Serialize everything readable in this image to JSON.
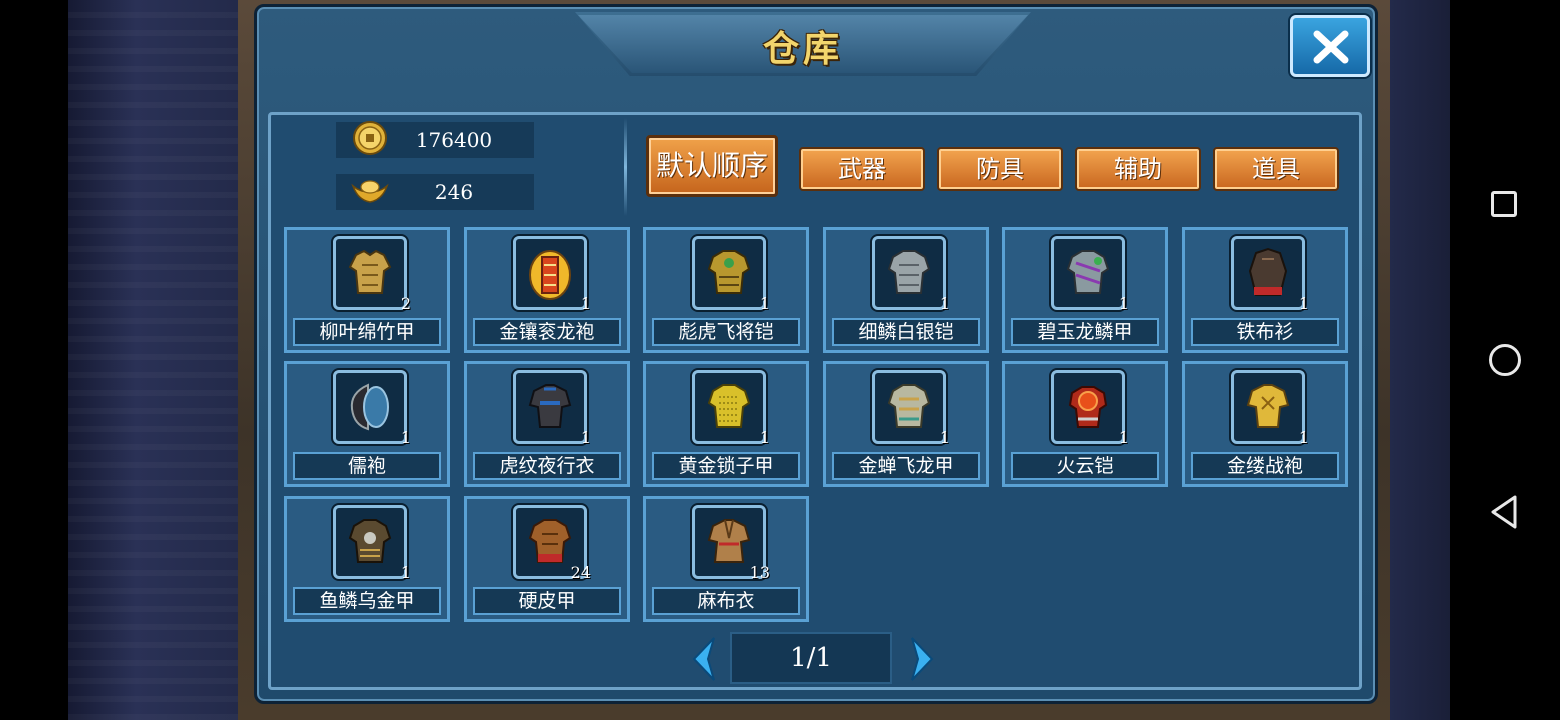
{
  "window": {
    "title": "仓库"
  },
  "currency": {
    "coins": "176400",
    "ingots": "246"
  },
  "sort": {
    "label": "默认顺序"
  },
  "categories": [
    "武器",
    "防具",
    "辅助",
    "道具"
  ],
  "items": [
    {
      "name": "柳叶绵竹甲",
      "count": "2",
      "icon": "armor-gold-icon"
    },
    {
      "name": "金镶衮龙袍",
      "count": "1",
      "icon": "robe-gold-icon"
    },
    {
      "name": "彪虎飞将铠",
      "count": "1",
      "icon": "armor-tiger-icon"
    },
    {
      "name": "细鳞白银铠",
      "count": "1",
      "icon": "armor-silver-icon"
    },
    {
      "name": "碧玉龙鳞甲",
      "count": "1",
      "icon": "armor-jade-icon"
    },
    {
      "name": "铁布衫",
      "count": "1",
      "icon": "robe-iron-icon"
    },
    {
      "name": "儒袍",
      "count": "1",
      "icon": "robe-scholar-icon"
    },
    {
      "name": "虎纹夜行衣",
      "count": "1",
      "icon": "robe-night-icon"
    },
    {
      "name": "黄金锁子甲",
      "count": "1",
      "icon": "armor-chain-gold-icon"
    },
    {
      "name": "金蝉飞龙甲",
      "count": "1",
      "icon": "armor-cicada-icon"
    },
    {
      "name": "火云铠",
      "count": "1",
      "icon": "armor-fire-icon"
    },
    {
      "name": "金缕战袍",
      "count": "1",
      "icon": "robe-goldthread-icon"
    },
    {
      "name": "鱼鳞乌金甲",
      "count": "1",
      "icon": "armor-fishscale-icon"
    },
    {
      "name": "硬皮甲",
      "count": "24",
      "icon": "armor-leather-icon"
    },
    {
      "name": "麻布衣",
      "count": "13",
      "icon": "robe-linen-icon"
    }
  ],
  "pager": {
    "text": "1/1"
  },
  "colors": {
    "accent_orange": "#d9792b",
    "panel_blue": "#2a5b82",
    "title_gold": "#f2d56c"
  }
}
